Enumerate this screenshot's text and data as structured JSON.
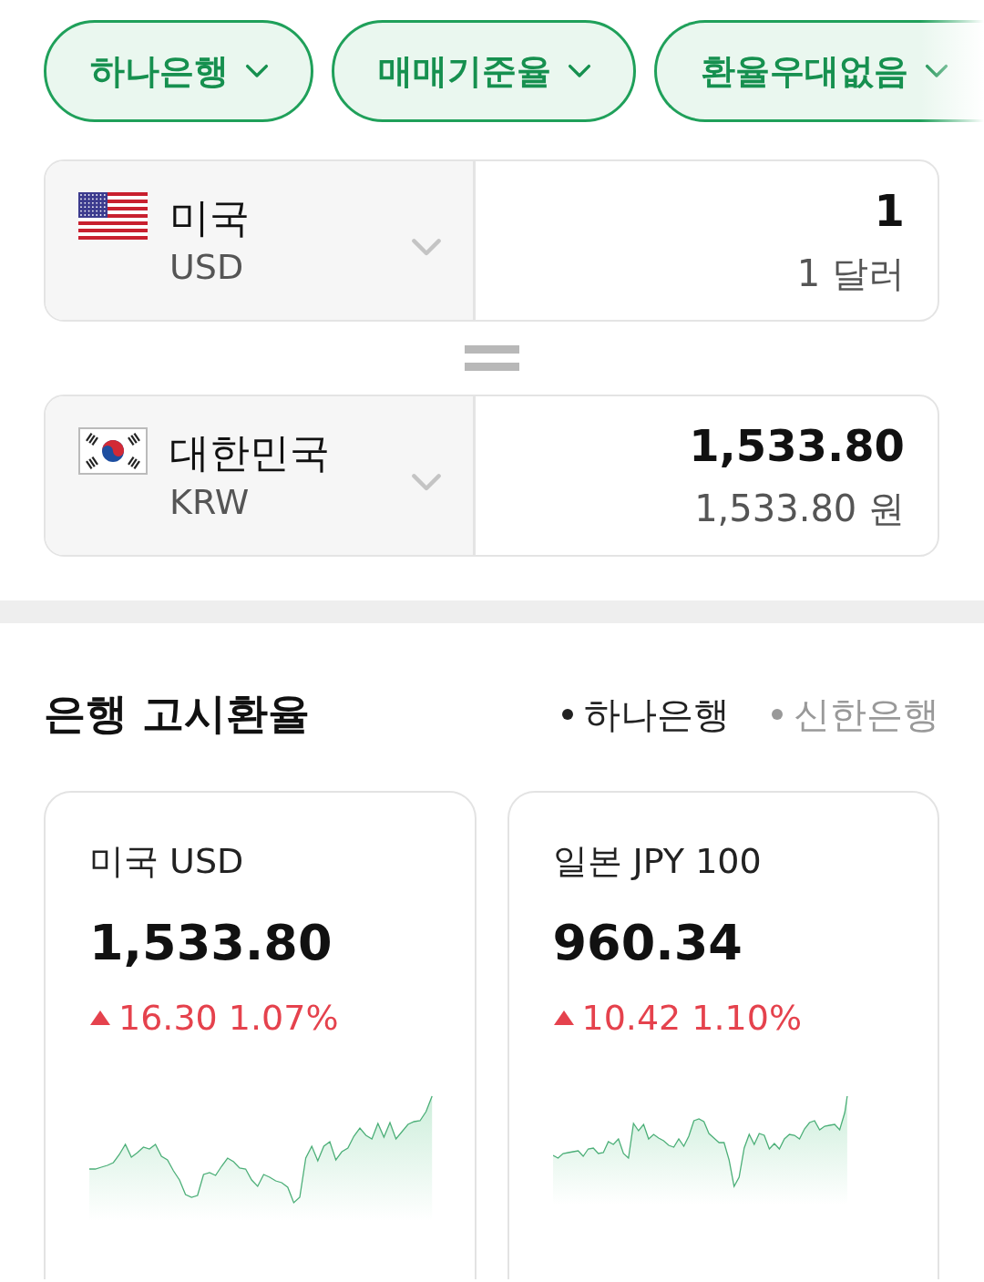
{
  "filters": [
    {
      "label": "하나은행"
    },
    {
      "label": "매매기준율"
    },
    {
      "label": "환율우대없음"
    }
  ],
  "converter": [
    {
      "kind": "us",
      "country": "미국",
      "code": "USD",
      "amount": "1",
      "amount_text": "1 달러"
    },
    {
      "kind": "kr",
      "country": "대한민국",
      "code": "KRW",
      "amount": "1,533.80",
      "amount_text": "1,533.80 원"
    }
  ],
  "section": {
    "title": "은행 고시환율",
    "banks": [
      {
        "label": "하나은행",
        "selected": true
      },
      {
        "label": "신한은행",
        "selected": false
      }
    ]
  },
  "cards": [
    {
      "title": "미국 USD",
      "rate": "1,533.80",
      "kind": "rise",
      "change": "16.30 1.07%"
    },
    {
      "title": "일본 JPY 100",
      "rate": "960.34",
      "kind": "rise",
      "change": "10.42 1.10%"
    }
  ]
}
